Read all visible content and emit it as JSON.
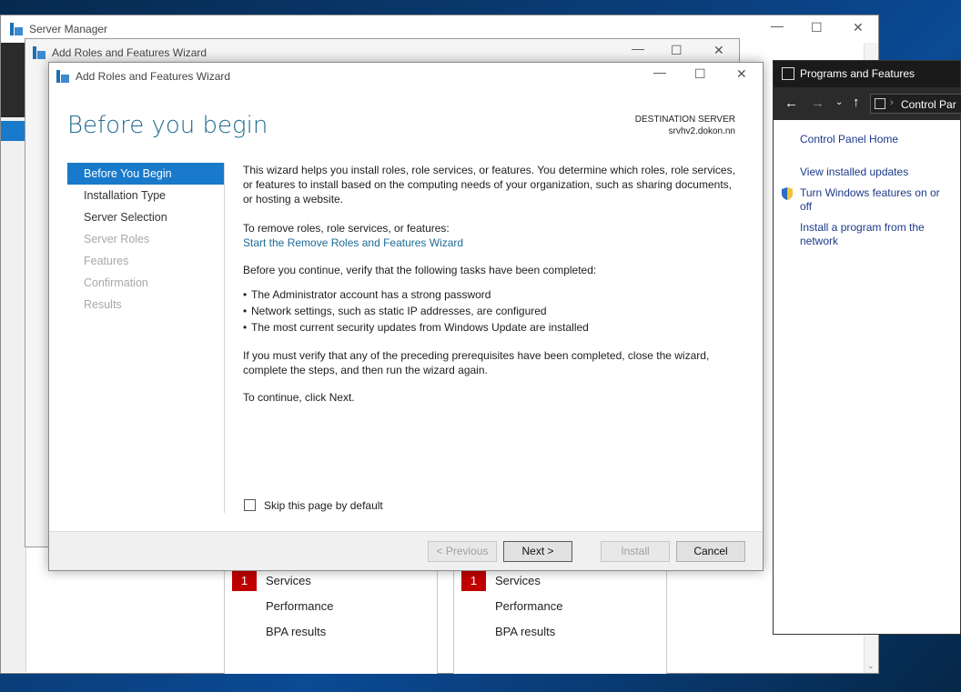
{
  "server_manager": {
    "title": "Server Manager",
    "tiles": [
      {
        "badge": "1",
        "services": "Services",
        "performance": "Performance",
        "bpa": "BPA results"
      },
      {
        "badge": "1",
        "services": "Services",
        "performance": "Performance",
        "bpa": "BPA results"
      }
    ]
  },
  "wizard_back": {
    "title": "Add Roles and Features Wizard"
  },
  "wizard": {
    "title": "Add Roles and Features Wizard",
    "heading": "Before you begin",
    "dest_label": "DESTINATION SERVER",
    "dest_server": "srvhv2.dokon.nn",
    "steps": [
      {
        "label": "Before You Begin"
      },
      {
        "label": "Installation Type"
      },
      {
        "label": "Server Selection"
      },
      {
        "label": "Server Roles"
      },
      {
        "label": "Features"
      },
      {
        "label": "Confirmation"
      },
      {
        "label": "Results"
      }
    ],
    "intro": "This wizard helps you install roles, role services, or features. You determine which roles, role services, or features to install based on the computing needs of your organization, such as sharing documents, or hosting a website.",
    "remove_text": "To remove roles, role services, or features:",
    "remove_link": "Start the Remove Roles and Features Wizard",
    "verify_text": "Before you continue, verify that the following tasks have been completed:",
    "bullets": [
      "The Administrator account has a strong password",
      "Network settings, such as static IP addresses, are configured",
      "The most current security updates from Windows Update are installed"
    ],
    "prereq_text": "If you must verify that any of the preceding prerequisites have been completed, close the wizard, complete the steps, and then run the wizard again.",
    "continue_text": "To continue, click Next.",
    "skip_label": "Skip this page by default",
    "buttons": {
      "previous": "< Previous",
      "next": "Next >",
      "install": "Install",
      "cancel": "Cancel"
    }
  },
  "programs": {
    "title": "Programs and Features",
    "address": "Control Par",
    "home": "Control Panel Home",
    "view_updates": "View installed updates",
    "turn_features": "Turn Windows features on or off",
    "install_program": "Install a program from the network"
  }
}
